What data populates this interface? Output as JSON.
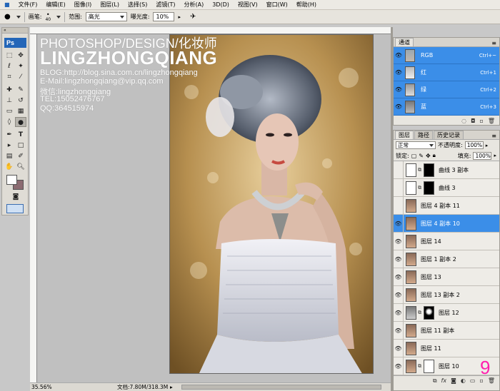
{
  "menu": [
    "文件(F)",
    "编辑(E)",
    "图像(I)",
    "图层(L)",
    "选择(S)",
    "滤镜(T)",
    "分析(A)",
    "3D(D)",
    "视图(V)",
    "窗口(W)",
    "帮助(H)"
  ],
  "options": {
    "brush_label": "画笔:",
    "brush_size": "40",
    "range_label": "范围:",
    "range_value": "高光",
    "exposure_label": "曝光度:",
    "exposure_value": "10%"
  },
  "toolbox": {
    "logo": "Ps"
  },
  "watermark": {
    "line1": "PHOTOSHOP/DESIGN/化妆师",
    "line2": "LINGZHONGQIANG",
    "line3": "BLOG:http://blog.sina.com.cn/lingzhongqiang",
    "line4": "E-Mail:lingzhongqiang@vip.qq.com",
    "line5": "微信:lingzhongqiang",
    "line6": "TEL:15052476767",
    "line7": "QQ:364515974"
  },
  "status": {
    "zoom": "35.56%",
    "doc": "文档:7.80M/318.3M"
  },
  "channels_panel": {
    "tab": "通道",
    "rows": [
      {
        "name": "RGB",
        "shortcut": "Ctrl+~"
      },
      {
        "name": "红",
        "shortcut": "Ctrl+1"
      },
      {
        "name": "绿",
        "shortcut": "Ctrl+2"
      },
      {
        "name": "蓝",
        "shortcut": "Ctrl+3"
      }
    ]
  },
  "layers_panel": {
    "tabs": [
      "图层",
      "路径",
      "历史记录"
    ],
    "blend_mode": "正常",
    "opacity_label": "不透明度:",
    "opacity_value": "100%",
    "lock_label": "锁定:",
    "fill_label": "填充:",
    "fill_value": "100%",
    "layers": [
      "曲线 3 副本",
      "曲线 3",
      "图层 4 副本 11",
      "图层 4 副本 10",
      "图层 14",
      "图层 1 副本 2",
      "图层 13",
      "图层 13 副本 2",
      "图层 12",
      "图层 11 副本",
      "图层 11",
      "图层 10"
    ]
  },
  "page_number": "9",
  "colors": {
    "selection": "#3b8ee8",
    "page_number": "#ff1fae"
  }
}
